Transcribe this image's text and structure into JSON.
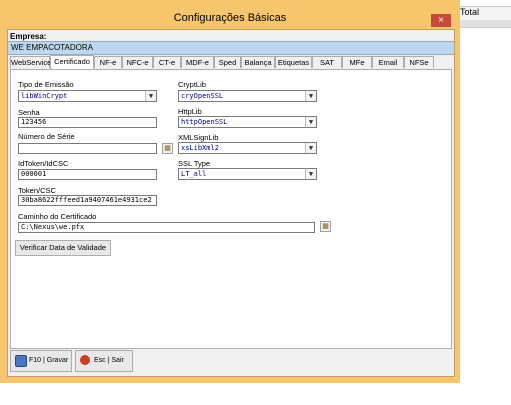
{
  "background": {
    "column_header": "Total"
  },
  "window": {
    "title": "Configurações Básicas",
    "close_glyph": "×"
  },
  "empresa": {
    "label": "Empresa:",
    "value": "WE EMPACOTADORA"
  },
  "tabs": [
    {
      "label": "WebService"
    },
    {
      "label": "Certificado"
    },
    {
      "label": "NF-e"
    },
    {
      "label": "NFC-e"
    },
    {
      "label": "CT-e"
    },
    {
      "label": "MDF-e"
    },
    {
      "label": "Sped"
    },
    {
      "label": "Balança"
    },
    {
      "label": "Etiquetas"
    },
    {
      "label": "SAT"
    },
    {
      "label": "MFe"
    },
    {
      "label": "Email"
    },
    {
      "label": "NFSe"
    }
  ],
  "active_tab": "Certificado",
  "form": {
    "tipo_emissao": {
      "label": "Tipo de Emissão",
      "value": "libWinCrypt"
    },
    "senha": {
      "label": "Senha",
      "value": "123456"
    },
    "numero_serie": {
      "label": "Número de Série",
      "value": ""
    },
    "idtoken": {
      "label": "IdToken/IdCSC",
      "value": "000001"
    },
    "token": {
      "label": "Token/CSC",
      "value": "30ba8622fffeed1a9407461e4931ce2"
    },
    "caminho": {
      "label": "Caminho do Certificado",
      "value": "C:\\Nexus\\we.pfx"
    },
    "cryptlib": {
      "label": "CryptLib",
      "value": "cryOpenSSL"
    },
    "httplib": {
      "label": "HttpLib",
      "value": "httpOpenSSL"
    },
    "xmlsignlib": {
      "label": "XMLSignLib",
      "value": "xsLibXml2"
    },
    "ssltype": {
      "label": "SSL Type",
      "value": "LT_all"
    },
    "verificar_button": "Verificar Data de Validade"
  },
  "footer": {
    "gravar": "F10 | Gravar",
    "sair": "Esc | Sair"
  },
  "icons": {
    "browse": "folder-icon",
    "save": "floppy-icon",
    "exit": "exit-icon"
  },
  "colors": {
    "window_frame": "#f7c56b",
    "close": "#c74a3a",
    "empresa_bar": "#bed7f1",
    "combo_text": "#000080"
  }
}
